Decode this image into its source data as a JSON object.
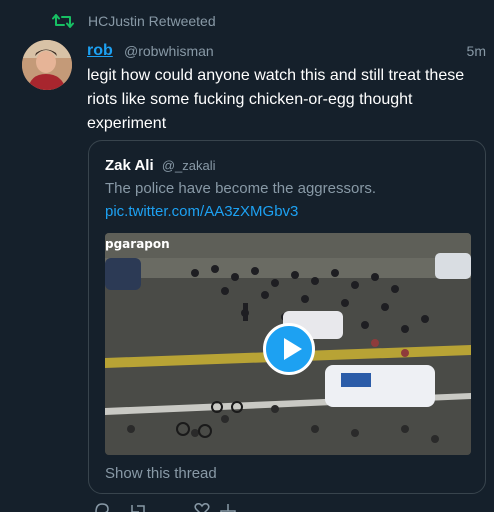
{
  "colors": {
    "background": "#15202b",
    "accent": "#1da1f2",
    "muted": "#8899a6",
    "retweet": "#17bf63"
  },
  "retweet": {
    "icon": "retweet-icon",
    "text": "HCJustin Retweeted"
  },
  "tweet": {
    "name": "rob",
    "handle": "@robwhisman",
    "time": "5m",
    "text": "legit how could anyone watch this and still treat these riots like some fucking chicken-or-egg thought experiment"
  },
  "quote": {
    "name": "Zak Ali",
    "handle": "@_zakali",
    "text": "The police have become the aggressors.",
    "link": "pic.twitter.com/AA3zXMGbv3",
    "media_watermark": "pgarapon",
    "media_icon": "play-icon",
    "show_thread": "Show this thread"
  },
  "actions": {
    "icons": [
      "reply-icon",
      "retweet-icon",
      "like-icon",
      "share-icon"
    ]
  }
}
